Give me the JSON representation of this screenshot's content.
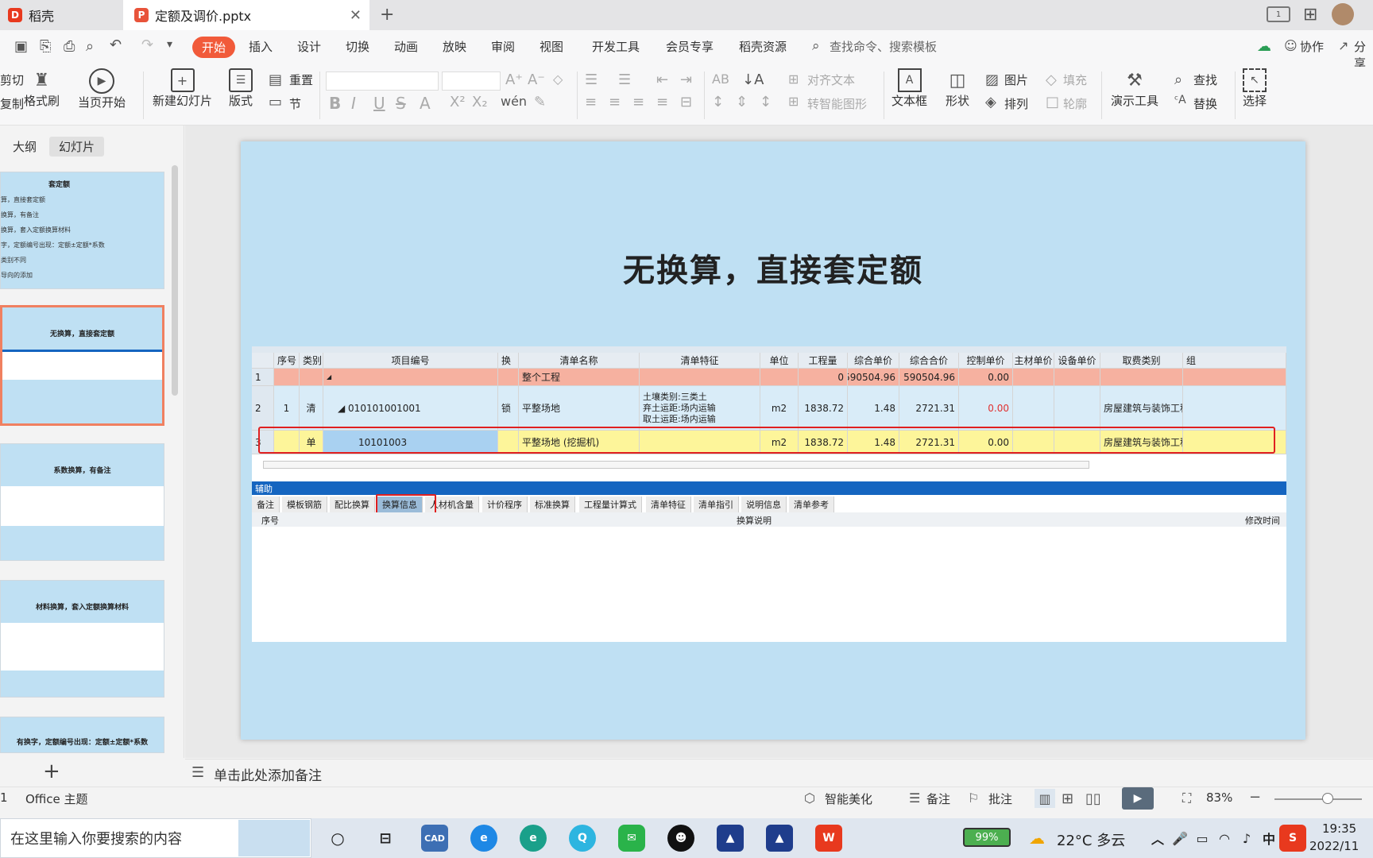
{
  "tabs": [
    {
      "label": "稻壳",
      "icon": "docer-logo-icon"
    },
    {
      "label": "定额及调价.pptx",
      "icon": "pptx-file-icon",
      "active": true
    }
  ],
  "menu": {
    "items": [
      "开始",
      "插入",
      "设计",
      "切换",
      "动画",
      "放映",
      "审阅",
      "视图",
      "开发工具",
      "会员专享",
      "稻壳资源"
    ],
    "search_placeholder": "查找命令、搜索模板",
    "collab": "协作",
    "share": "分享",
    "active_color": "#f15a3a"
  },
  "ribbon": {
    "cut": "剪切",
    "copy": "复制",
    "format_painter": "格式刷",
    "from_current": "当页开始",
    "new_slide": "新建幻灯片",
    "layout": "版式",
    "reset": "重置",
    "section": "节",
    "align_text": "对齐文本",
    "convert_smart": "转智能图形",
    "textbox": "文本框",
    "shape": "形状",
    "picture": "图片",
    "arrange": "排列",
    "fill": "填充",
    "outline": "轮廓",
    "present_tools": "演示工具",
    "find": "查找",
    "replace": "替换",
    "select": "选择"
  },
  "left_panel": {
    "tab_outline": "大纲",
    "tab_slides": "幻灯片",
    "thumbs": [
      {
        "title": "套定额",
        "lines": [
          "算，直接套定额",
          "换算，有备注",
          "换算，套入定额换算材料",
          "字，定额编号出现：定额±定额*系数",
          "类别不同",
          "导向的添加"
        ]
      },
      {
        "title": "无换算，直接套定额",
        "lines": []
      },
      {
        "title": "系数换算，有备注",
        "lines": []
      },
      {
        "title": "材料换算，套入定额换算材料",
        "lines": []
      },
      {
        "title": "有换字，定额编号出现：定额±定额*系数",
        "lines": []
      }
    ],
    "add_icon": "plus-icon"
  },
  "slide": {
    "title": "无换算，直接套定额",
    "grid": {
      "headers": [
        "序号",
        "类别",
        "项目编号",
        "换",
        "清单名称",
        "清单特征",
        "单位",
        "工程量",
        "综合单价",
        "综合合价",
        "控制单价",
        "主材单价",
        "设备单价",
        "取费类别",
        "组"
      ],
      "rows": [
        {
          "no": "1",
          "seq": "",
          "type": "",
          "code": "◢",
          "swap": "",
          "name": "整个工程",
          "feature": "",
          "unit": "",
          "qty": "0",
          "price": "590504.96",
          "total": "590504.96",
          "ctrl": "0.00",
          "fee": ""
        },
        {
          "no": "2",
          "seq": "1",
          "type": "清",
          "code": "◢ 010101001001",
          "swap": "锁",
          "name": "平整场地",
          "feature": "土壤类别:三类土\n弃土运距:场内运输\n取土运距:场内运输",
          "unit": "m2",
          "qty": "1838.72",
          "price": "1.48",
          "total": "2721.31",
          "ctrl": "0.00",
          "fee": "房屋建筑与装饰工程"
        },
        {
          "no": "3",
          "seq": "",
          "type": "单",
          "code": "10101003",
          "swap": "",
          "name": "平整场地 (挖掘机)",
          "feature": "",
          "unit": "m2",
          "qty": "1838.72",
          "price": "1.48",
          "total": "2721.31",
          "ctrl": "0.00",
          "fee": "房屋建筑与装饰工程"
        }
      ]
    },
    "assist_label": "辅助",
    "assist_tabs": [
      "备注",
      "模板钢筋",
      "配比换算",
      "换算信息",
      "人材机含量",
      "计价程序",
      "标准换算",
      "工程量计算式",
      "清单特征",
      "清单指引",
      "说明信息",
      "清单参考"
    ],
    "assist_active": "换算信息",
    "assist_headers": [
      "序号",
      "换算说明",
      "修改时间"
    ]
  },
  "notes_placeholder": "单击此处添加备注",
  "status": {
    "slide_num": "1",
    "theme": "Office 主题",
    "beautify": "智能美化",
    "notes": "备注",
    "comments": "批注",
    "zoom": "83%"
  },
  "taskbar": {
    "search_placeholder": "在这里输入你要搜索的内容",
    "battery": "99%",
    "weather": "22°C 多云",
    "time": "19:35",
    "date": "2022/11"
  }
}
